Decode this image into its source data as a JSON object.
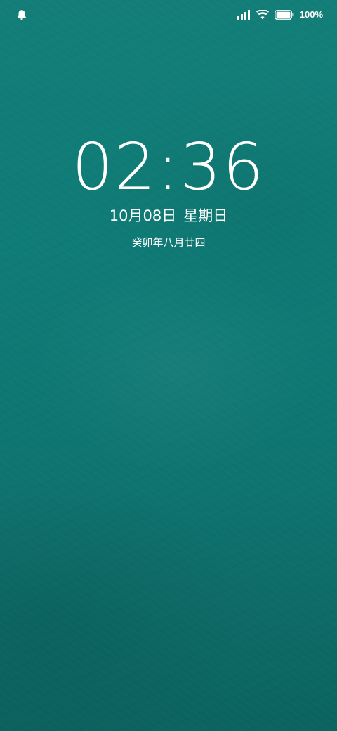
{
  "status_bar": {
    "notification_icon": "bell-icon",
    "signal_icon": "cellular-signal-icon",
    "wifi_icon": "wifi-icon",
    "battery_icon": "battery-icon",
    "battery_percent": "100%",
    "battery_level": 1.0
  },
  "lock_screen": {
    "time": "02:36",
    "date": "10月08日",
    "weekday": "星期日",
    "lunar_date": "癸卯年八月廿四"
  },
  "colors": {
    "wallpaper": "#0f7c77",
    "text": "#ffffff"
  }
}
